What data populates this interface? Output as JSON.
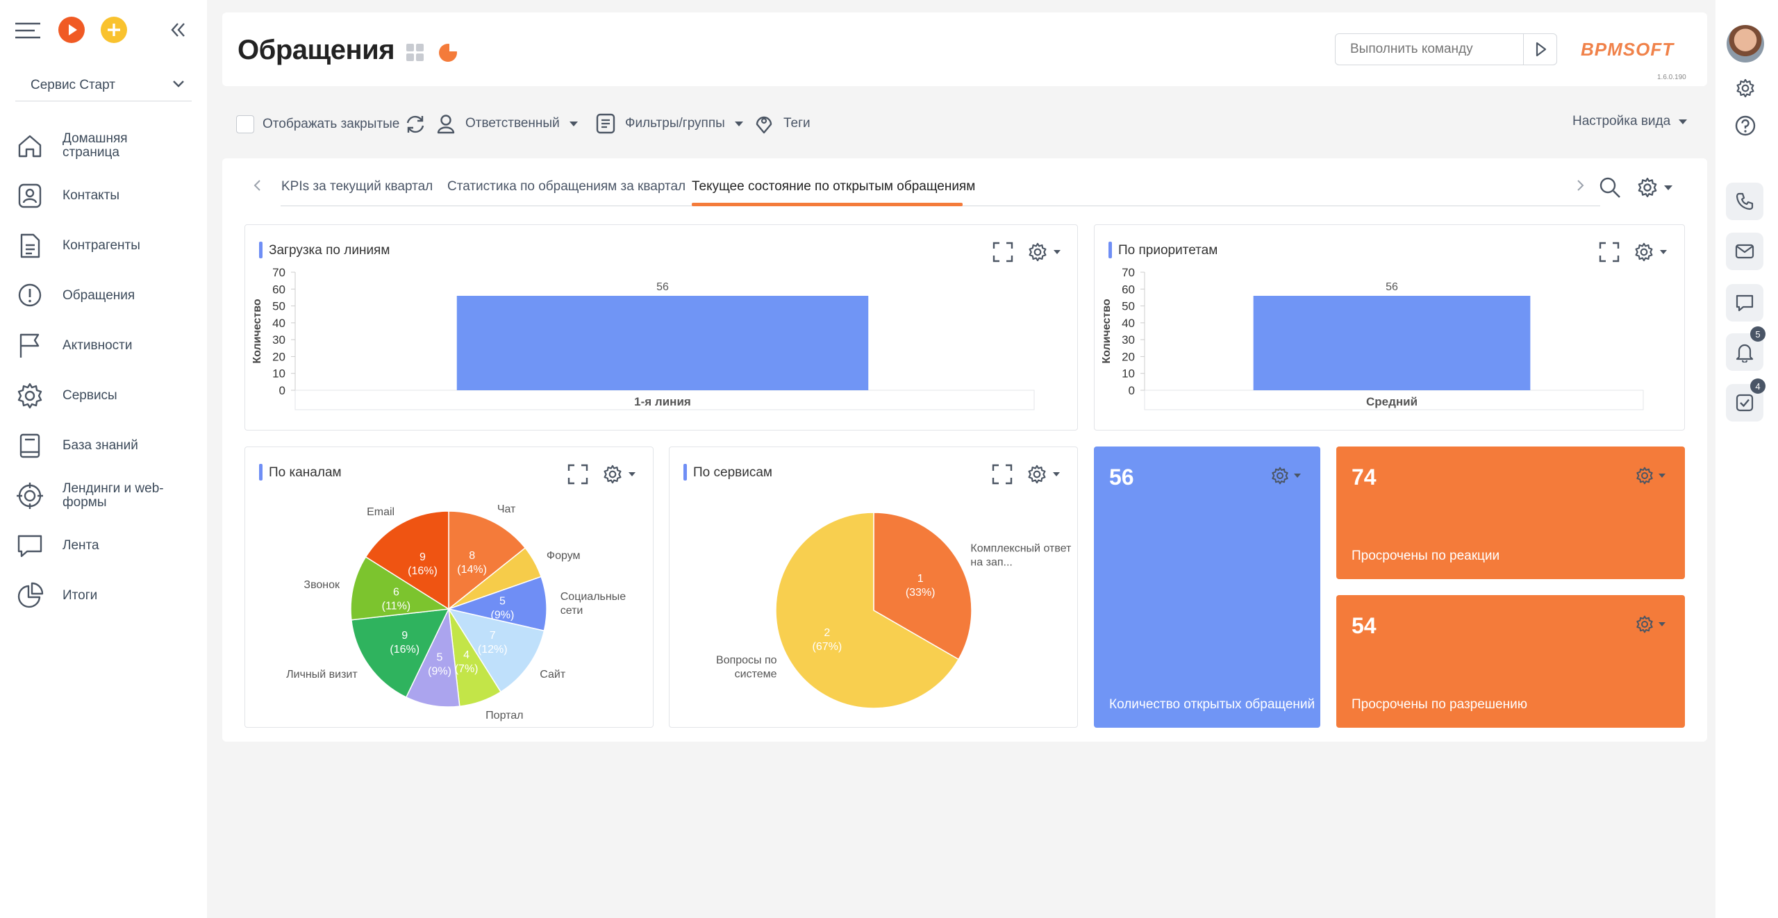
{
  "sidebar": {
    "workspace": "Сервис Старт",
    "items": [
      {
        "label": "Домашняя страница",
        "icon": "home-icon"
      },
      {
        "label": "Контакты",
        "icon": "contact-icon"
      },
      {
        "label": "Контрагенты",
        "icon": "document-icon"
      },
      {
        "label": "Обращения",
        "icon": "alert-icon"
      },
      {
        "label": "Активности",
        "icon": "flag-icon"
      },
      {
        "label": "Сервисы",
        "icon": "gear-icon"
      },
      {
        "label": "База знаний",
        "icon": "book-icon"
      },
      {
        "label": "Лендинги и web-формы",
        "icon": "target-icon"
      },
      {
        "label": "Лента",
        "icon": "chat-icon"
      },
      {
        "label": "Итоги",
        "icon": "pie-icon"
      }
    ]
  },
  "header": {
    "title": "Обращения",
    "command_placeholder": "Выполнить команду",
    "logo": "BPMSOFT",
    "version": "1.6.0.190"
  },
  "toolbar": {
    "show_closed": "Отображать закрытые",
    "responsible": "Ответственный",
    "filters": "Фильтры/группы",
    "tags": "Теги",
    "view_settings": "Настройка вида"
  },
  "tabs": [
    {
      "label": "KPIs за текущий квартал",
      "active": false
    },
    {
      "label": "Статистика по обращениям за квартал",
      "active": false
    },
    {
      "label": "Текущее состояние по открытым обращениям",
      "active": true
    }
  ],
  "colors": {
    "accent": "#f47b3a",
    "bar": "#7095f5",
    "tile_blue": "#7095f5",
    "tile_orange": "#f47b3a"
  },
  "widgets": {
    "by_lines": {
      "title": "Загрузка по линиям"
    },
    "by_priority": {
      "title": "По приоритетам"
    },
    "by_channels": {
      "title": "По каналам"
    },
    "by_services": {
      "title": "По сервисам"
    },
    "open_count": {
      "value": "56",
      "caption": "Количество открытых обращений"
    },
    "overdue_reaction": {
      "value": "74",
      "caption": "Просрочены по реакции"
    },
    "overdue_resolution": {
      "value": "54",
      "caption": "Просрочены по разрешению"
    }
  },
  "rail": {
    "notifications_badge": "5",
    "tasks_badge": "4"
  },
  "chart_data": [
    {
      "type": "bar",
      "title": "Загрузка по линиям",
      "ylabel": "Количество",
      "categories": [
        "1-я линия"
      ],
      "values": [
        56
      ],
      "ylim": [
        0,
        70
      ],
      "yticks": [
        0,
        10,
        20,
        30,
        40,
        50,
        60,
        70
      ]
    },
    {
      "type": "bar",
      "title": "По приоритетам",
      "ylabel": "Количество",
      "categories": [
        "Средний"
      ],
      "values": [
        56
      ],
      "ylim": [
        0,
        70
      ],
      "yticks": [
        0,
        10,
        20,
        30,
        40,
        50,
        60,
        70
      ]
    },
    {
      "type": "pie",
      "title": "По каналам",
      "slices": [
        {
          "label": "Чат",
          "value": 8,
          "pct": "14%",
          "color": "#f47b3a"
        },
        {
          "label": "Форум",
          "value": 3,
          "pct": "5%",
          "color": "#f6cc4a"
        },
        {
          "label": "Социальные сети",
          "value": 5,
          "pct": "9%",
          "color": "#6f8ef5"
        },
        {
          "label": "Сайт",
          "value": 7,
          "pct": "12%",
          "color": "#bfe0fb"
        },
        {
          "label": "Портал",
          "value": 4,
          "pct": "7%",
          "color": "#c3e548"
        },
        {
          "label": "",
          "value": 5,
          "pct": "9%",
          "color": "#aba4ee"
        },
        {
          "label": "Личный визит",
          "value": 9,
          "pct": "16%",
          "color": "#2fb35e"
        },
        {
          "label": "Звонок",
          "value": 6,
          "pct": "11%",
          "color": "#7cc42e"
        },
        {
          "label": "Email",
          "value": 9,
          "pct": "16%",
          "color": "#ef5412"
        }
      ]
    },
    {
      "type": "pie",
      "title": "По сервисам",
      "slices": [
        {
          "label": "Комплексный ответ на зап...",
          "value": 1,
          "pct": "33%",
          "color": "#f47b3a"
        },
        {
          "label": "Вопросы по системе",
          "value": 2,
          "pct": "67%",
          "color": "#f8cf4f"
        }
      ]
    }
  ]
}
